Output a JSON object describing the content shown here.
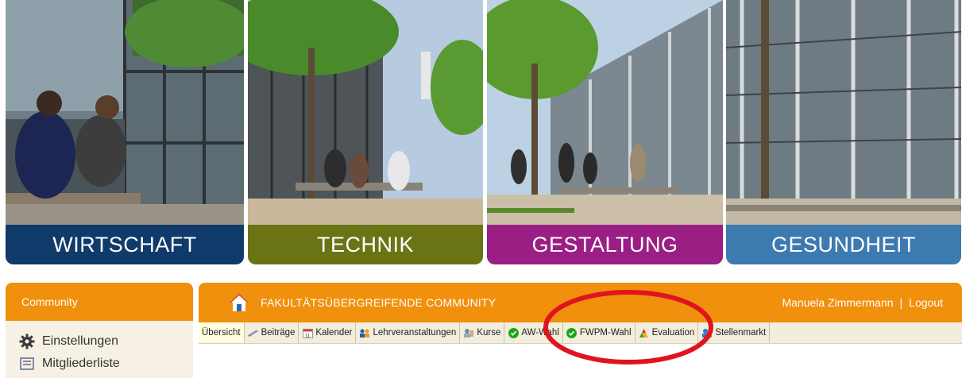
{
  "banner": {
    "panels": [
      {
        "label": "WIRTSCHAFT",
        "color": "#0f3a6a"
      },
      {
        "label": "TECHNIK",
        "color": "#6a7415"
      },
      {
        "label": "GESTALTUNG",
        "color": "#9b1e84"
      },
      {
        "label": "GESUNDHEIT",
        "color": "#3c7ab0"
      }
    ]
  },
  "sidebar": {
    "header": "Community",
    "items": [
      {
        "label": "Einstellungen",
        "icon": "gear-icon"
      },
      {
        "label": "Mitgliederliste",
        "icon": "list-icon"
      }
    ]
  },
  "main": {
    "title": "FAKULTÄTSÜBERGREIFENDE COMMUNITY",
    "user_name": "Manuela Zimmermann",
    "separator": "|",
    "logout": "Logout",
    "tabs": [
      {
        "label": "Übersicht",
        "icon": ""
      },
      {
        "label": "Beiträge",
        "icon": "pen-icon"
      },
      {
        "label": "Kalender",
        "icon": "calendar-icon"
      },
      {
        "label": "Lehrveranstaltungen",
        "icon": "people-icon"
      },
      {
        "label": "Kurse",
        "icon": "course-icon"
      },
      {
        "label": "AW-Wahl",
        "icon": "check-icon"
      },
      {
        "label": "FWPM-Wahl",
        "icon": "check-icon"
      },
      {
        "label": "Evaluation",
        "icon": "chart-icon"
      },
      {
        "label": "Stellenmarkt",
        "icon": "market-icon"
      }
    ]
  },
  "colors": {
    "accent": "#f0900d",
    "annotation": "#e0141e"
  }
}
